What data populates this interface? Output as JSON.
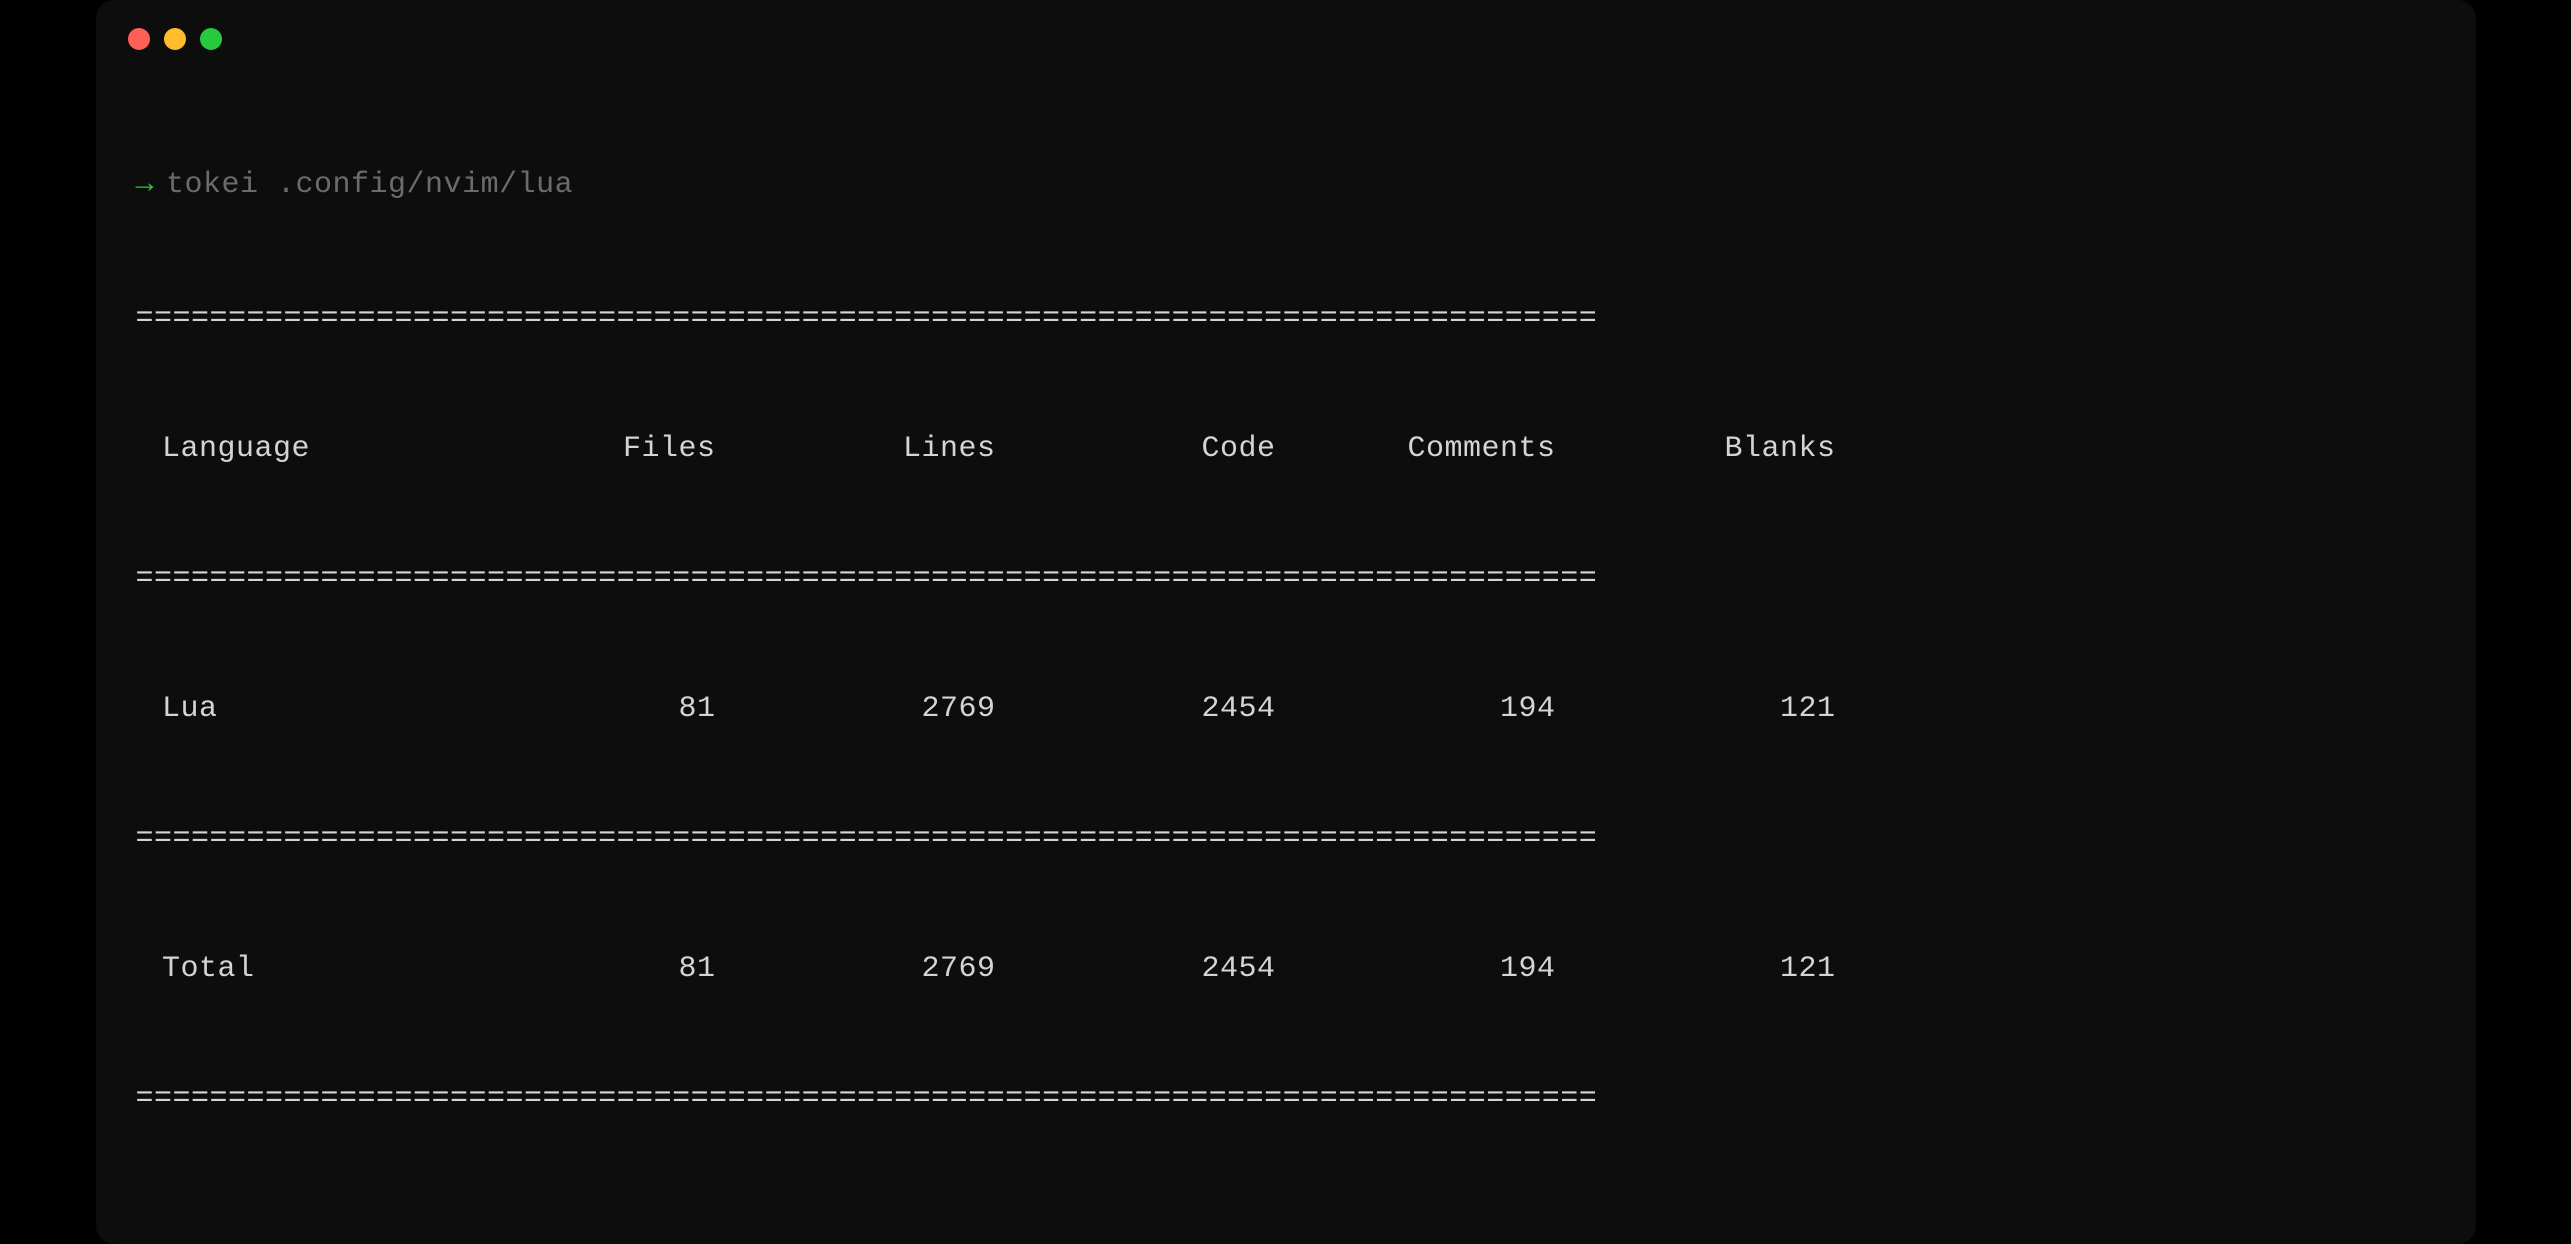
{
  "prompt": {
    "arrow": "→",
    "command": "tokei .config/nvim/lua"
  },
  "divider": "===============================================================================",
  "headers": {
    "language": " Language",
    "files": "Files",
    "lines": "Lines",
    "code": "Code",
    "comments": "Comments",
    "blanks": "Blanks"
  },
  "rows": [
    {
      "language": " Lua",
      "files": "81",
      "lines": "2769",
      "code": "2454",
      "comments": "194",
      "blanks": "121"
    }
  ],
  "total": {
    "language": " Total",
    "files": "81",
    "lines": "2769",
    "code": "2454",
    "comments": "194",
    "blanks": "121"
  }
}
